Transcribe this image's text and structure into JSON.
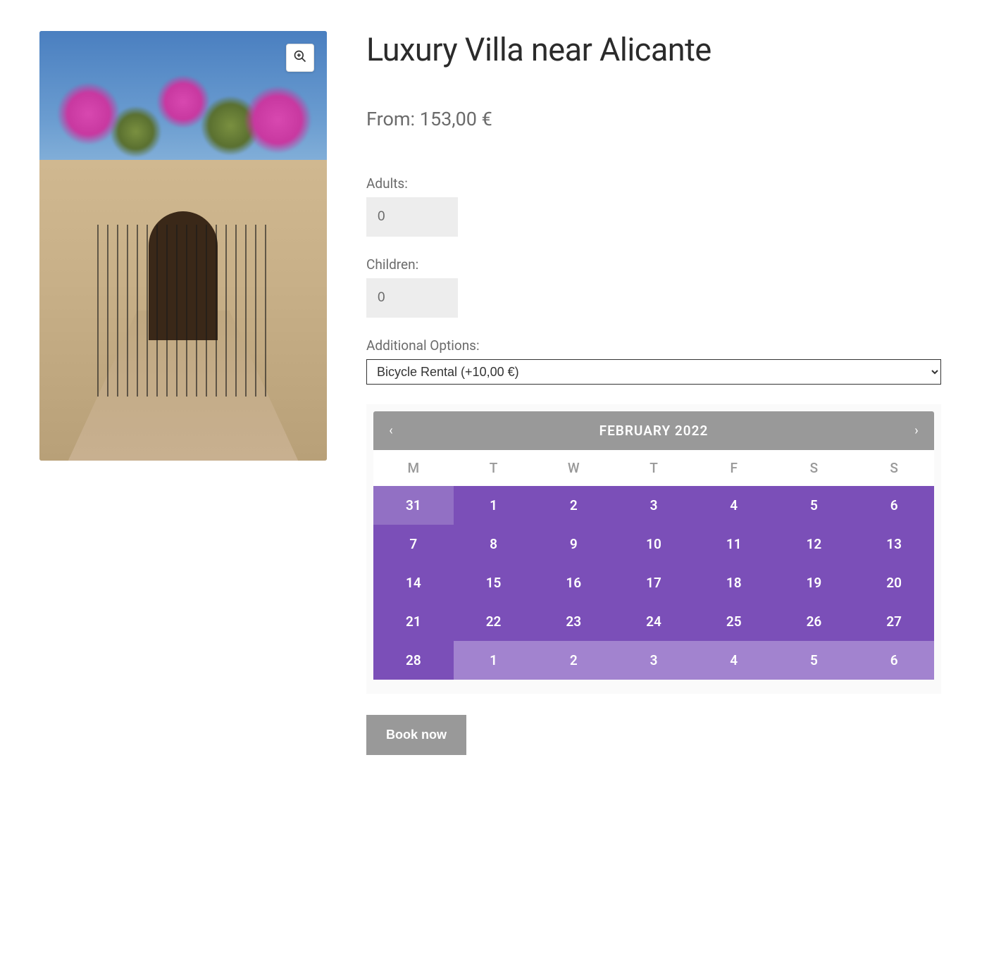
{
  "product": {
    "title": "Luxury Villa near Alicante",
    "price_prefix": "From: ",
    "price": "153,00 €"
  },
  "form": {
    "adults_label": "Adults:",
    "adults_value": "0",
    "children_label": "Children:",
    "children_value": "0",
    "options_label": "Additional Options:",
    "options_selected": "Bicycle Rental (+10,00 €)",
    "book_label": "Book now"
  },
  "calendar": {
    "month_label": "FEBRUARY 2022",
    "dow": [
      "M",
      "T",
      "W",
      "T",
      "F",
      "S",
      "S"
    ],
    "days": [
      {
        "n": "31",
        "outside": true,
        "first": true
      },
      {
        "n": "1"
      },
      {
        "n": "2"
      },
      {
        "n": "3"
      },
      {
        "n": "4"
      },
      {
        "n": "5"
      },
      {
        "n": "6"
      },
      {
        "n": "7"
      },
      {
        "n": "8"
      },
      {
        "n": "9"
      },
      {
        "n": "10"
      },
      {
        "n": "11"
      },
      {
        "n": "12"
      },
      {
        "n": "13"
      },
      {
        "n": "14"
      },
      {
        "n": "15"
      },
      {
        "n": "16"
      },
      {
        "n": "17"
      },
      {
        "n": "18"
      },
      {
        "n": "19"
      },
      {
        "n": "20"
      },
      {
        "n": "21"
      },
      {
        "n": "22"
      },
      {
        "n": "23"
      },
      {
        "n": "24"
      },
      {
        "n": "25"
      },
      {
        "n": "26"
      },
      {
        "n": "27"
      },
      {
        "n": "28"
      },
      {
        "n": "1",
        "outside": true
      },
      {
        "n": "2",
        "outside": true
      },
      {
        "n": "3",
        "outside": true
      },
      {
        "n": "4",
        "outside": true
      },
      {
        "n": "5",
        "outside": true
      },
      {
        "n": "6",
        "outside": true
      }
    ]
  },
  "icons": {
    "zoom": "zoom-in-icon",
    "prev": "‹",
    "next": "›"
  }
}
